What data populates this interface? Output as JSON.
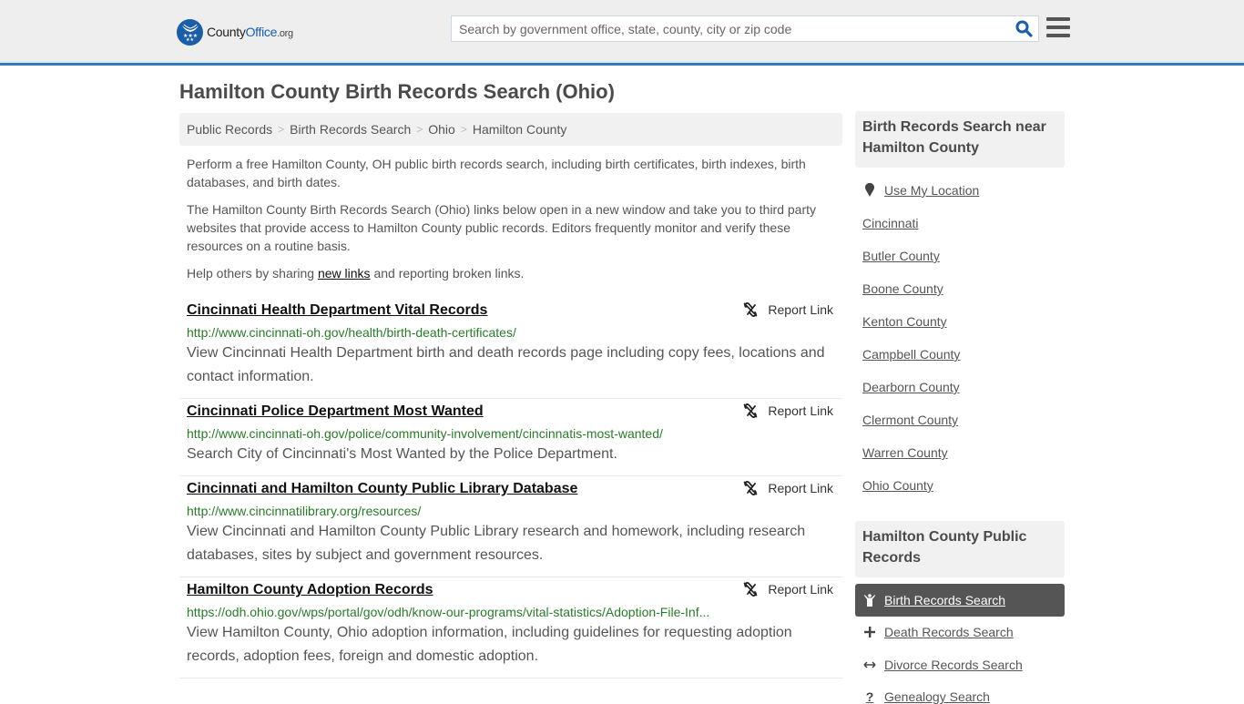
{
  "header": {
    "logo": {
      "name_part1": "County",
      "name_part2": "Office",
      "tld": ".org"
    },
    "search": {
      "placeholder": "Search by government office, state, county, city or zip code",
      "value": ""
    },
    "icons": {
      "search": "search-icon",
      "menu": "hamburger-menu-icon",
      "logo": "eagle-stars-logo-icon"
    }
  },
  "page": {
    "title": "Hamilton County Birth Records Search (Ohio)",
    "breadcrumb": [
      {
        "label": "Public Records"
      },
      {
        "label": "Birth Records Search"
      },
      {
        "label": "Ohio"
      },
      {
        "label": "Hamilton County"
      }
    ],
    "breadcrumb_separator": ">",
    "intro": {
      "p1": "Perform a free Hamilton County, OH public birth records search, including birth certificates, birth indexes, birth databases, and birth dates.",
      "p2": "The Hamilton County Birth Records Search (Ohio) links below open in a new window and take you to third party websites that provide access to Hamilton County public records. Editors frequently monitor and verify these resources on a routine basis.",
      "p3_before": "Help others by sharing ",
      "p3_link": "new links",
      "p3_after": " and reporting broken links."
    }
  },
  "results": [
    {
      "title": "Cincinnati Health Department Vital Records",
      "url": "http://www.cincinnati-oh.gov/health/birth-death-certificates/",
      "description": "View Cincinnati Health Department birth and death records page including copy fees, locations and contact information.",
      "report_label": "Report Link"
    },
    {
      "title": "Cincinnati Police Department Most Wanted",
      "url": "http://www.cincinnati-oh.gov/police/community-involvement/cincinnatis-most-wanted/",
      "description": "Search City of Cincinnati's Most Wanted by the Police Department.",
      "report_label": "Report Link"
    },
    {
      "title": "Cincinnati and Hamilton County Public Library Database",
      "url": "http://www.cincinnatilibrary.org/resources/",
      "description": "View Cincinnati and Hamilton County Public Library research and homework, including research databases, sites by subject and government resources.",
      "report_label": "Report Link"
    },
    {
      "title": "Hamilton County Adoption Records",
      "url": "https://odh.ohio.gov/wps/portal/gov/odh/know-our-programs/vital-statistics/Adoption-File-Inf...",
      "description": "View Hamilton County, Ohio adoption information, including guidelines for requesting adoption records, adoption fees, foreign and domestic adoption.",
      "report_label": "Report Link"
    }
  ],
  "sidebar": {
    "nearby": {
      "heading": "Birth Records Search near Hamilton County",
      "use_location": "Use My Location",
      "links": [
        "Cincinnati",
        "Butler County",
        "Boone County",
        "Kenton County",
        "Campbell County",
        "Dearborn County",
        "Clermont County",
        "Warren County",
        "Ohio County"
      ]
    },
    "public_records": {
      "heading": "Hamilton County Public Records",
      "items": [
        {
          "label": "Birth Records Search",
          "icon": "child-icon",
          "active": true
        },
        {
          "label": "Death Records Search",
          "icon": "plus-cross-icon",
          "active": false
        },
        {
          "label": "Divorce Records Search",
          "icon": "left-right-arrow-icon",
          "active": false
        },
        {
          "label": "Genealogy Search",
          "icon": "question-icon",
          "active": false
        }
      ]
    }
  },
  "colors": {
    "header_bg": "#eeeeee",
    "header_border": "#337ab7",
    "brand_blue": "#1a5ea8",
    "url_green": "#2b7a2b",
    "active_item_bg": "#555555"
  }
}
